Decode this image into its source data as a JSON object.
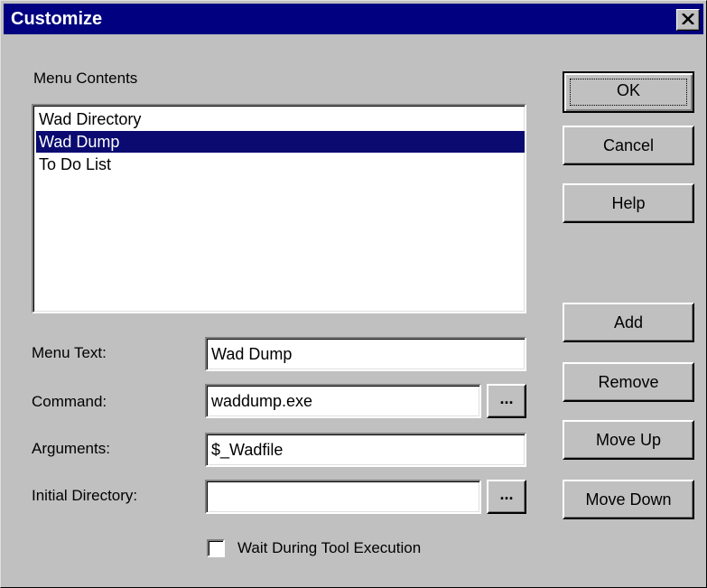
{
  "window": {
    "title": "Customize"
  },
  "labels": {
    "menu_contents": "Menu Contents",
    "menu_text": "Menu Text:",
    "command": "Command:",
    "arguments": "Arguments:",
    "initial_directory": "Initial Directory:",
    "wait_checkbox": "Wait During Tool Execution"
  },
  "list": {
    "items": [
      "Wad Directory",
      "Wad Dump",
      "To Do List"
    ],
    "selected_index": 1
  },
  "fields": {
    "menu_text": "Wad Dump",
    "command": "waddump.exe",
    "arguments": "$_Wadfile",
    "initial_directory": ""
  },
  "buttons": {
    "ok": "OK",
    "cancel": "Cancel",
    "help": "Help",
    "add": "Add",
    "remove": "Remove",
    "move_up": "Move Up",
    "move_down": "Move Down",
    "browse": "..."
  },
  "checkbox": {
    "wait_checked": false
  },
  "colors": {
    "title_bar": "#000080",
    "selection": "#0a0a70",
    "face": "#c0c0c0"
  }
}
